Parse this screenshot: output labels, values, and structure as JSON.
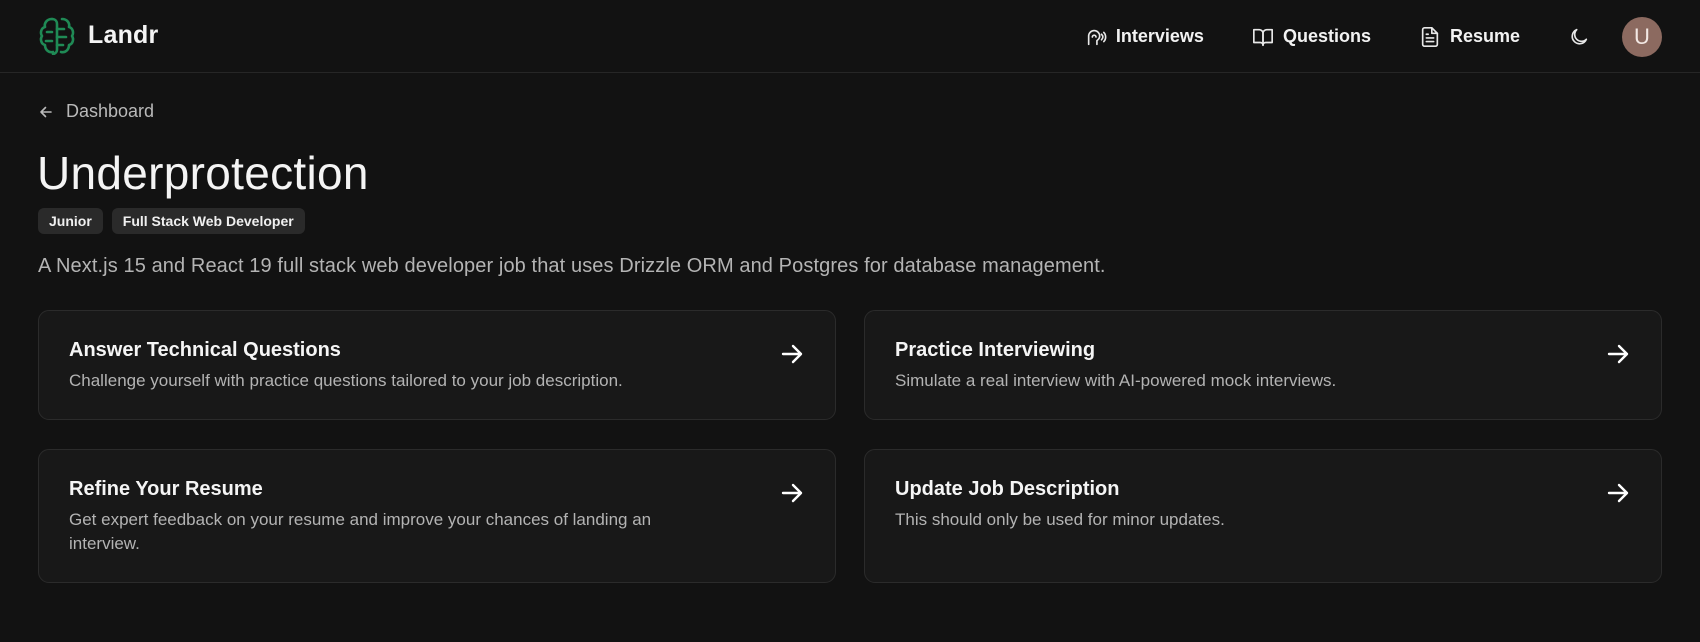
{
  "app": {
    "name": "Landr",
    "logo_icon": "brain-icon",
    "accent": "#1f8a55"
  },
  "nav": {
    "items": [
      {
        "label": "Interviews",
        "icon": "interview-speech-icon"
      },
      {
        "label": "Questions",
        "icon": "book-open-icon"
      },
      {
        "label": "Resume",
        "icon": "file-text-icon"
      }
    ],
    "theme_icon": "moon-icon",
    "avatar_initial": "U",
    "avatar_color": "#8c6a60"
  },
  "breadcrumb": {
    "label": "Dashboard",
    "icon": "arrow-left-icon"
  },
  "job": {
    "title": "Underprotection",
    "badges": [
      "Junior",
      "Full Stack Web Developer"
    ],
    "description": "A Next.js 15 and React 19 full stack web developer job that uses Drizzle ORM and Postgres for database management."
  },
  "cards": [
    {
      "title": "Answer Technical Questions",
      "subtitle": "Challenge yourself with practice questions tailored to your job description."
    },
    {
      "title": "Practice Interviewing",
      "subtitle": "Simulate a real interview with AI-powered mock interviews."
    },
    {
      "title": "Refine Your Resume",
      "subtitle": "Get expert feedback on your resume and improve your chances of landing an interview."
    },
    {
      "title": "Update Job Description",
      "subtitle": "This should only be used for minor updates."
    }
  ]
}
